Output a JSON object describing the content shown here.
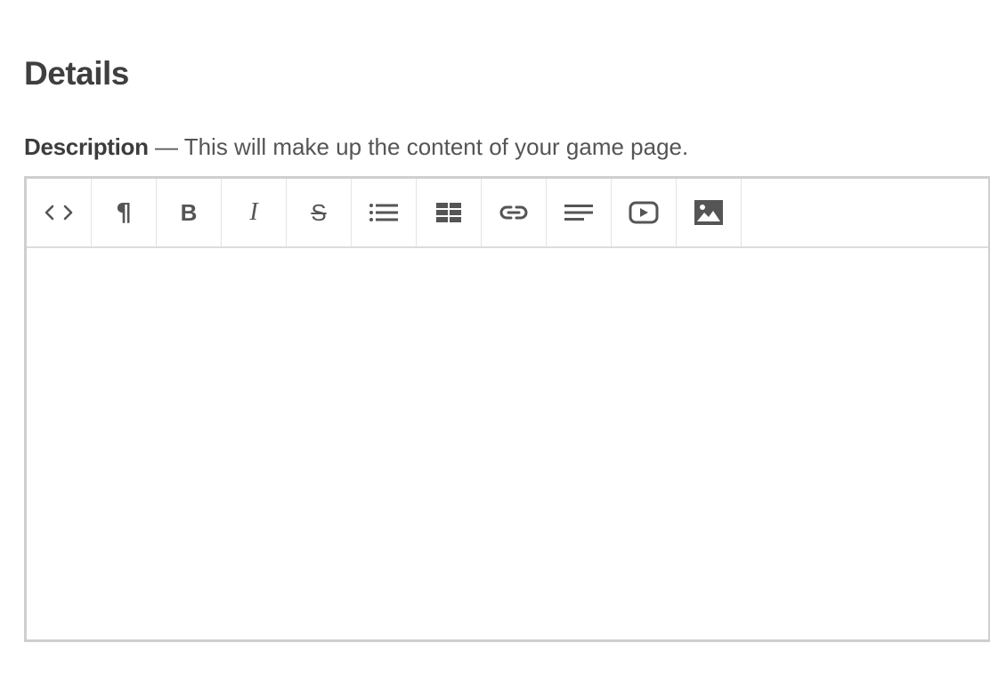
{
  "section": {
    "title": "Details"
  },
  "description": {
    "label": "Description",
    "hint": " — This will make up the content of your game page.",
    "value": ""
  },
  "toolbar": {
    "items": [
      {
        "name": "code-view",
        "icon": "code-icon"
      },
      {
        "name": "paragraph-format",
        "icon": "paragraph-icon",
        "glyph": "¶"
      },
      {
        "name": "bold",
        "icon": "bold-icon",
        "glyph": "B"
      },
      {
        "name": "italic",
        "icon": "italic-icon",
        "glyph": "I"
      },
      {
        "name": "strikethrough",
        "icon": "strikethrough-icon",
        "glyph": "S"
      },
      {
        "name": "unordered-list",
        "icon": "bullet-list-icon"
      },
      {
        "name": "insert-table",
        "icon": "table-icon"
      },
      {
        "name": "insert-link",
        "icon": "link-icon"
      },
      {
        "name": "align",
        "icon": "align-left-icon"
      },
      {
        "name": "insert-video",
        "icon": "video-icon"
      },
      {
        "name": "insert-image",
        "icon": "image-icon"
      }
    ]
  },
  "colors": {
    "text": "#444444",
    "icon": "#555555",
    "border": "#cfcfcf"
  }
}
